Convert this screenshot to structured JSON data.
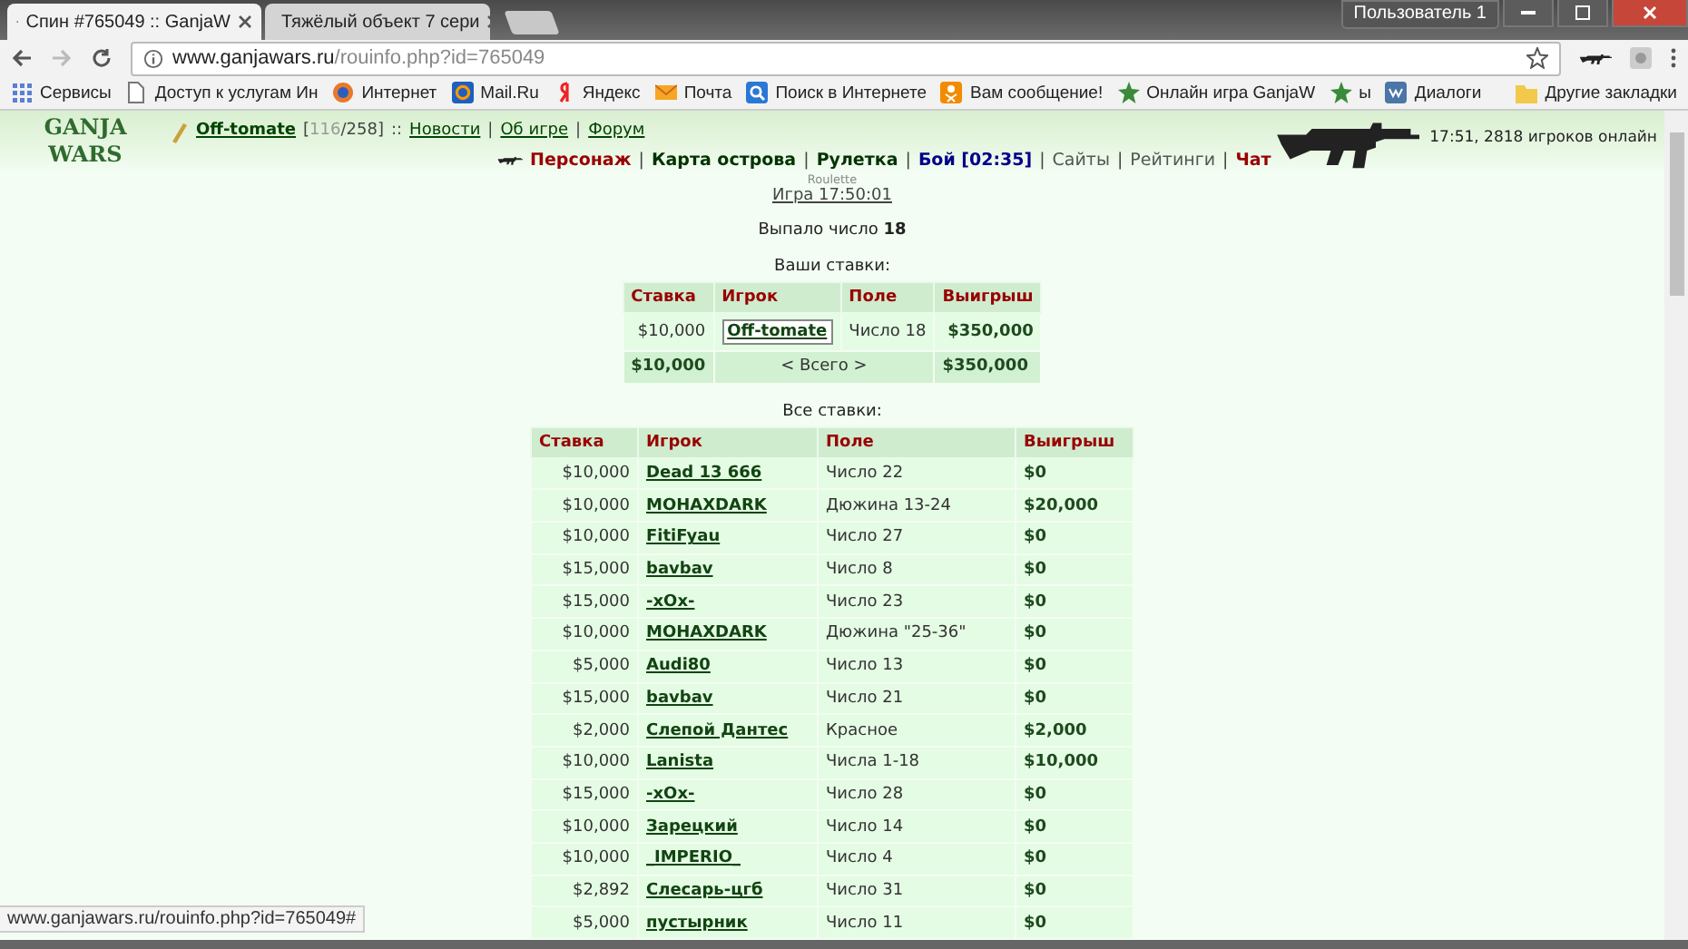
{
  "browser": {
    "tabs": [
      {
        "title": "Спин #765049 :: GanjaW",
        "kind": "star",
        "selected": true
      },
      {
        "title": "Тяжёлый объект 7 сери",
        "kind": "video",
        "selected": false
      }
    ],
    "profile": "Пользователь 1",
    "address": {
      "host": "www.ganjawars.ru",
      "path": "/rouinfo.php?id=765049"
    },
    "bookmarks": [
      {
        "label": "Сервисы",
        "kind": "apps"
      },
      {
        "label": "Доступ к услугам Ин",
        "kind": "page"
      },
      {
        "label": "Интернет",
        "kind": "globe"
      },
      {
        "label": "Mail.Ru",
        "kind": "at"
      },
      {
        "label": "Яндекс",
        "kind": "ya"
      },
      {
        "label": "Почта",
        "kind": "mail"
      },
      {
        "label": "Поиск в Интернете",
        "kind": "search"
      },
      {
        "label": "Вам сообщение!",
        "kind": "ok"
      },
      {
        "label": "Онлайн игра GanjaW",
        "kind": "star"
      },
      {
        "label": "ы",
        "kind": "star"
      },
      {
        "label": "Диалоги",
        "kind": "vk"
      }
    ],
    "other_bookmarks": "Другие закладки"
  },
  "header": {
    "logo": [
      "GANJA",
      "WARS"
    ],
    "user": "Off-tomate",
    "hp_before": "[",
    "hp_current": "116",
    "hp_after": "/258]",
    "links_separator": "::",
    "links": [
      "Новости",
      "Об игре",
      "Форум"
    ],
    "status": "17:51, 2818 игроков онлайн",
    "nav_separator": "|",
    "nav": [
      {
        "label": "Персонаж",
        "kind": "alert"
      },
      {
        "label": "Карта острова",
        "kind": "bold"
      },
      {
        "label": "Рулетка",
        "kind": "bold"
      },
      {
        "label": "Бой [02:35]",
        "kind": "fight"
      },
      {
        "label": "Сайты",
        "kind": "plain"
      },
      {
        "label": "Рейтинги",
        "kind": "plain"
      },
      {
        "label": "Чат",
        "kind": "alert"
      }
    ]
  },
  "game": {
    "label": "Roulette",
    "title": "Игра 17:50:01",
    "result_text": "Выпало число",
    "result_number": "18",
    "my_bets": {
      "caption": "Ваши ставки:",
      "columns": [
        "Ставка",
        "Игрок",
        "Поле",
        "Выигрыш"
      ],
      "rows": [
        {
          "bet": "$10,000",
          "player": "Off-tomate",
          "field": "Число 18",
          "win": "$350,000",
          "highlighted": true
        }
      ],
      "total": {
        "bet": "$10,000",
        "label": "< Всего >",
        "win": "$350,000"
      }
    },
    "all_bets": {
      "caption": "Все ставки:",
      "columns": [
        "Ставка",
        "Игрок",
        "Поле",
        "Выигрыш"
      ],
      "rows": [
        {
          "bet": "$10,000",
          "player": "Dead 13 666",
          "field": "Число 22",
          "win": "$0"
        },
        {
          "bet": "$10,000",
          "player": "MOHAXDARK",
          "field": "Дюжина 13-24",
          "win": "$20,000"
        },
        {
          "bet": "$10,000",
          "player": "FitiFyau",
          "field": "Число 27",
          "win": "$0"
        },
        {
          "bet": "$15,000",
          "player": "bavbav",
          "field": "Число 8",
          "win": "$0"
        },
        {
          "bet": "$15,000",
          "player": "-xOx-",
          "field": "Число 23",
          "win": "$0"
        },
        {
          "bet": "$10,000",
          "player": "MOHAXDARK",
          "field": "Дюжина \"25-36\"",
          "win": "$0"
        },
        {
          "bet": "$5,000",
          "player": "Audi80",
          "field": "Число 13",
          "win": "$0"
        },
        {
          "bet": "$15,000",
          "player": "bavbav",
          "field": "Число 21",
          "win": "$0"
        },
        {
          "bet": "$2,000",
          "player": "Слепой Дантес",
          "field": "Красное",
          "win": "$2,000"
        },
        {
          "bet": "$10,000",
          "player": "Lanista",
          "field": "Числа 1-18",
          "win": "$10,000"
        },
        {
          "bet": "$15,000",
          "player": "-xOx-",
          "field": "Число 28",
          "win": "$0"
        },
        {
          "bet": "$10,000",
          "player": "Зарецкий",
          "field": "Число 14",
          "win": "$0"
        },
        {
          "bet": "$10,000",
          "player": "_IMPERIO_",
          "field": "Число 4",
          "win": "$0"
        },
        {
          "bet": "$2,892",
          "player": "Слесарь-цгб",
          "field": "Число 31",
          "win": "$0"
        },
        {
          "bet": "$5,000",
          "player": "пустырник",
          "field": "Число 11",
          "win": "$0"
        }
      ]
    }
  },
  "status_bar": "www.ganjawars.ru/rouinfo.php?id=765049#"
}
